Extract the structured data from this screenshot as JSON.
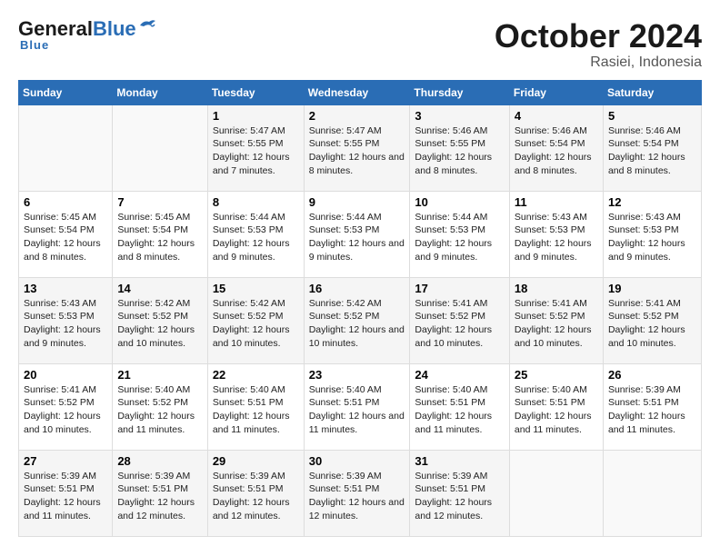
{
  "header": {
    "logo_general": "General",
    "logo_blue": "Blue",
    "month_title": "October 2024",
    "subtitle": "Rasiei, Indonesia"
  },
  "days_of_week": [
    "Sunday",
    "Monday",
    "Tuesday",
    "Wednesday",
    "Thursday",
    "Friday",
    "Saturday"
  ],
  "weeks": [
    [
      {
        "day": "",
        "sunrise": "",
        "sunset": "",
        "daylight": ""
      },
      {
        "day": "",
        "sunrise": "",
        "sunset": "",
        "daylight": ""
      },
      {
        "day": "1",
        "sunrise": "Sunrise: 5:47 AM",
        "sunset": "Sunset: 5:55 PM",
        "daylight": "Daylight: 12 hours and 7 minutes."
      },
      {
        "day": "2",
        "sunrise": "Sunrise: 5:47 AM",
        "sunset": "Sunset: 5:55 PM",
        "daylight": "Daylight: 12 hours and 8 minutes."
      },
      {
        "day": "3",
        "sunrise": "Sunrise: 5:46 AM",
        "sunset": "Sunset: 5:55 PM",
        "daylight": "Daylight: 12 hours and 8 minutes."
      },
      {
        "day": "4",
        "sunrise": "Sunrise: 5:46 AM",
        "sunset": "Sunset: 5:54 PM",
        "daylight": "Daylight: 12 hours and 8 minutes."
      },
      {
        "day": "5",
        "sunrise": "Sunrise: 5:46 AM",
        "sunset": "Sunset: 5:54 PM",
        "daylight": "Daylight: 12 hours and 8 minutes."
      }
    ],
    [
      {
        "day": "6",
        "sunrise": "Sunrise: 5:45 AM",
        "sunset": "Sunset: 5:54 PM",
        "daylight": "Daylight: 12 hours and 8 minutes."
      },
      {
        "day": "7",
        "sunrise": "Sunrise: 5:45 AM",
        "sunset": "Sunset: 5:54 PM",
        "daylight": "Daylight: 12 hours and 8 minutes."
      },
      {
        "day": "8",
        "sunrise": "Sunrise: 5:44 AM",
        "sunset": "Sunset: 5:53 PM",
        "daylight": "Daylight: 12 hours and 9 minutes."
      },
      {
        "day": "9",
        "sunrise": "Sunrise: 5:44 AM",
        "sunset": "Sunset: 5:53 PM",
        "daylight": "Daylight: 12 hours and 9 minutes."
      },
      {
        "day": "10",
        "sunrise": "Sunrise: 5:44 AM",
        "sunset": "Sunset: 5:53 PM",
        "daylight": "Daylight: 12 hours and 9 minutes."
      },
      {
        "day": "11",
        "sunrise": "Sunrise: 5:43 AM",
        "sunset": "Sunset: 5:53 PM",
        "daylight": "Daylight: 12 hours and 9 minutes."
      },
      {
        "day": "12",
        "sunrise": "Sunrise: 5:43 AM",
        "sunset": "Sunset: 5:53 PM",
        "daylight": "Daylight: 12 hours and 9 minutes."
      }
    ],
    [
      {
        "day": "13",
        "sunrise": "Sunrise: 5:43 AM",
        "sunset": "Sunset: 5:53 PM",
        "daylight": "Daylight: 12 hours and 9 minutes."
      },
      {
        "day": "14",
        "sunrise": "Sunrise: 5:42 AM",
        "sunset": "Sunset: 5:52 PM",
        "daylight": "Daylight: 12 hours and 10 minutes."
      },
      {
        "day": "15",
        "sunrise": "Sunrise: 5:42 AM",
        "sunset": "Sunset: 5:52 PM",
        "daylight": "Daylight: 12 hours and 10 minutes."
      },
      {
        "day": "16",
        "sunrise": "Sunrise: 5:42 AM",
        "sunset": "Sunset: 5:52 PM",
        "daylight": "Daylight: 12 hours and 10 minutes."
      },
      {
        "day": "17",
        "sunrise": "Sunrise: 5:41 AM",
        "sunset": "Sunset: 5:52 PM",
        "daylight": "Daylight: 12 hours and 10 minutes."
      },
      {
        "day": "18",
        "sunrise": "Sunrise: 5:41 AM",
        "sunset": "Sunset: 5:52 PM",
        "daylight": "Daylight: 12 hours and 10 minutes."
      },
      {
        "day": "19",
        "sunrise": "Sunrise: 5:41 AM",
        "sunset": "Sunset: 5:52 PM",
        "daylight": "Daylight: 12 hours and 10 minutes."
      }
    ],
    [
      {
        "day": "20",
        "sunrise": "Sunrise: 5:41 AM",
        "sunset": "Sunset: 5:52 PM",
        "daylight": "Daylight: 12 hours and 10 minutes."
      },
      {
        "day": "21",
        "sunrise": "Sunrise: 5:40 AM",
        "sunset": "Sunset: 5:52 PM",
        "daylight": "Daylight: 12 hours and 11 minutes."
      },
      {
        "day": "22",
        "sunrise": "Sunrise: 5:40 AM",
        "sunset": "Sunset: 5:51 PM",
        "daylight": "Daylight: 12 hours and 11 minutes."
      },
      {
        "day": "23",
        "sunrise": "Sunrise: 5:40 AM",
        "sunset": "Sunset: 5:51 PM",
        "daylight": "Daylight: 12 hours and 11 minutes."
      },
      {
        "day": "24",
        "sunrise": "Sunrise: 5:40 AM",
        "sunset": "Sunset: 5:51 PM",
        "daylight": "Daylight: 12 hours and 11 minutes."
      },
      {
        "day": "25",
        "sunrise": "Sunrise: 5:40 AM",
        "sunset": "Sunset: 5:51 PM",
        "daylight": "Daylight: 12 hours and 11 minutes."
      },
      {
        "day": "26",
        "sunrise": "Sunrise: 5:39 AM",
        "sunset": "Sunset: 5:51 PM",
        "daylight": "Daylight: 12 hours and 11 minutes."
      }
    ],
    [
      {
        "day": "27",
        "sunrise": "Sunrise: 5:39 AM",
        "sunset": "Sunset: 5:51 PM",
        "daylight": "Daylight: 12 hours and 11 minutes."
      },
      {
        "day": "28",
        "sunrise": "Sunrise: 5:39 AM",
        "sunset": "Sunset: 5:51 PM",
        "daylight": "Daylight: 12 hours and 12 minutes."
      },
      {
        "day": "29",
        "sunrise": "Sunrise: 5:39 AM",
        "sunset": "Sunset: 5:51 PM",
        "daylight": "Daylight: 12 hours and 12 minutes."
      },
      {
        "day": "30",
        "sunrise": "Sunrise: 5:39 AM",
        "sunset": "Sunset: 5:51 PM",
        "daylight": "Daylight: 12 hours and 12 minutes."
      },
      {
        "day": "31",
        "sunrise": "Sunrise: 5:39 AM",
        "sunset": "Sunset: 5:51 PM",
        "daylight": "Daylight: 12 hours and 12 minutes."
      },
      {
        "day": "",
        "sunrise": "",
        "sunset": "",
        "daylight": ""
      },
      {
        "day": "",
        "sunrise": "",
        "sunset": "",
        "daylight": ""
      }
    ]
  ]
}
